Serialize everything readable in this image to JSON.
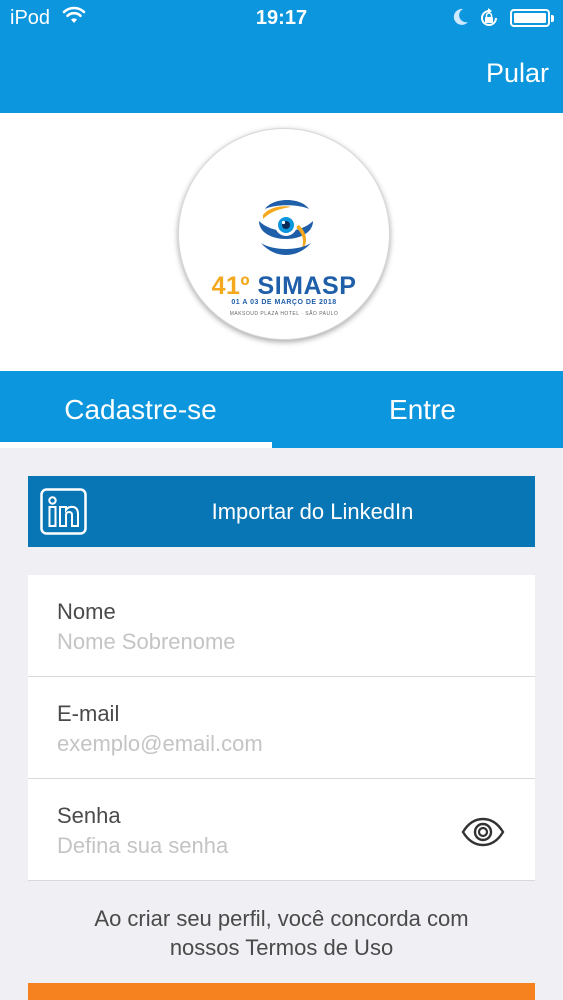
{
  "status_bar": {
    "carrier": "iPod",
    "time": "19:17",
    "battery_level": 1.0
  },
  "nav": {
    "skip_label": "Pular"
  },
  "logo": {
    "edition": "41º",
    "name": "SIMASP",
    "dates": "01 A 03 DE MARÇO DE 2018",
    "venue": "MAKSOUD PLAZA HOTEL · SÃO PAULO"
  },
  "tabs": [
    {
      "label": "Cadastre-se",
      "selected": true
    },
    {
      "label": "Entre",
      "selected": false
    }
  ],
  "linkedin": {
    "label": "Importar do LinkedIn"
  },
  "form": {
    "name": {
      "label": "Nome",
      "placeholder": "Nome Sobrenome",
      "value": ""
    },
    "email": {
      "label": "E-mail",
      "placeholder": "exemplo@email.com",
      "value": ""
    },
    "password": {
      "label": "Senha",
      "placeholder": "Defina sua senha",
      "value": ""
    }
  },
  "terms": {
    "line1": "Ao criar seu perfil, você concorda com",
    "line2": "nossos Termos de Uso"
  },
  "colors": {
    "primary": "#0b96dd",
    "linkedin": "#0876b5",
    "accent": "#f6821f",
    "background": "#efeff4"
  }
}
